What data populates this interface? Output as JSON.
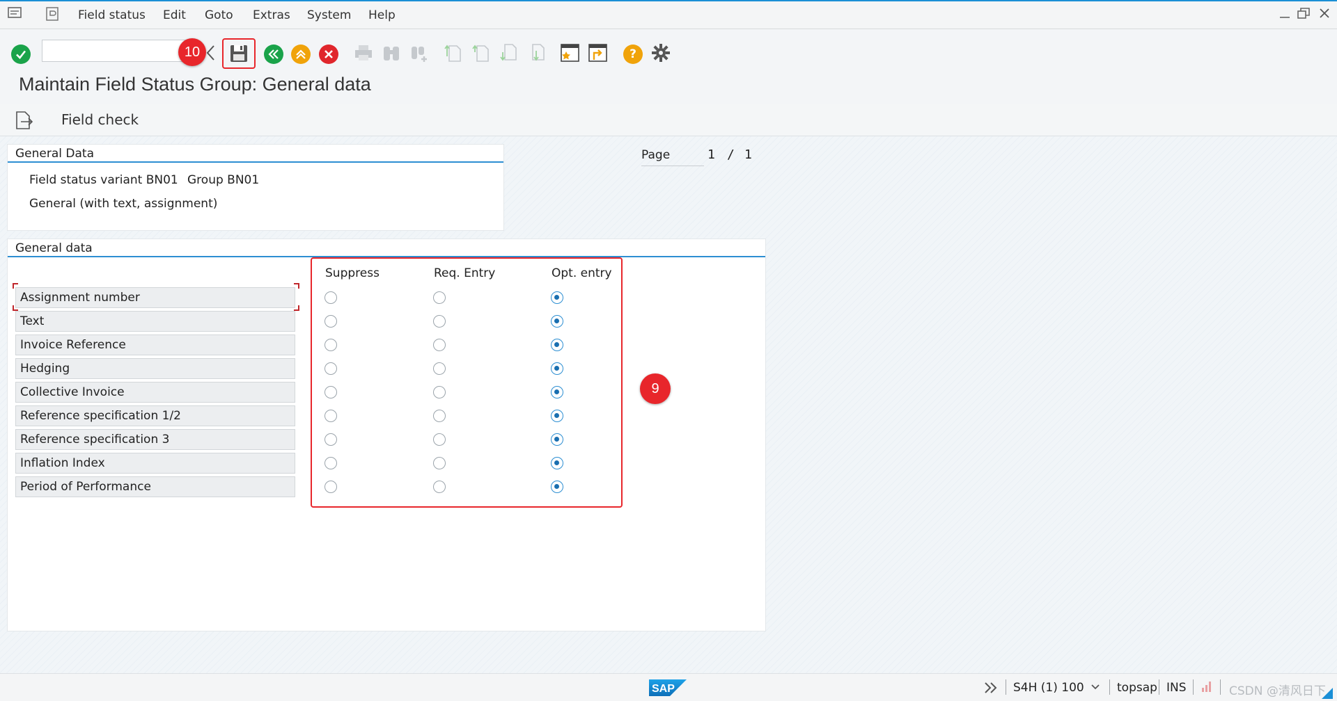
{
  "menu": {
    "items": [
      {
        "label": "Field status",
        "key": "F"
      },
      {
        "label": "Edit",
        "key": "E"
      },
      {
        "label": "Goto",
        "key": "G"
      },
      {
        "label": "Extras",
        "key": "x"
      },
      {
        "label": "System",
        "key": "S"
      },
      {
        "label": "Help",
        "key": "H"
      }
    ]
  },
  "toolbar": {
    "command_value": "",
    "marker_save": "10"
  },
  "page": {
    "title": "Maintain Field Status Group: General data",
    "field_check_label": "Field check",
    "page_label": "Page",
    "page_current": "1",
    "page_sep": "/",
    "page_total": "1"
  },
  "general_data_box": {
    "title": "General Data",
    "variant_label": "Field status variant BN01",
    "group_label": "Group BN01",
    "description": "General (with text, assignment)"
  },
  "general_data_table": {
    "title": "General data",
    "columns": [
      "Suppress",
      "Req. Entry",
      "Opt. entry"
    ],
    "rows": [
      {
        "label": "Assignment number",
        "selected": "Opt. entry"
      },
      {
        "label": "Text",
        "selected": "Opt. entry"
      },
      {
        "label": "Invoice Reference",
        "selected": "Opt. entry"
      },
      {
        "label": "Hedging",
        "selected": "Opt. entry"
      },
      {
        "label": "Collective Invoice",
        "selected": "Opt. entry"
      },
      {
        "label": "Reference specification 1/2",
        "selected": "Opt. entry"
      },
      {
        "label": "Reference specification 3",
        "selected": "Opt. entry"
      },
      {
        "label": "Inflation Index",
        "selected": "Opt. entry"
      },
      {
        "label": "Period of Performance",
        "selected": "Opt. entry"
      }
    ],
    "marker": "9"
  },
  "status_bar": {
    "logo": "SAP",
    "system": "S4H (1) 100",
    "host": "topsap",
    "mode": "INS",
    "watermark": "CSDN @清风日下"
  },
  "colors": {
    "accent": "#2c8ed2",
    "marker": "#e8262b",
    "ok_green": "#1aa34a",
    "back_green": "#1aa34a",
    "exit_orange": "#f0a30a",
    "cancel_red": "#e0262c",
    "help_orange": "#f0a30a"
  }
}
